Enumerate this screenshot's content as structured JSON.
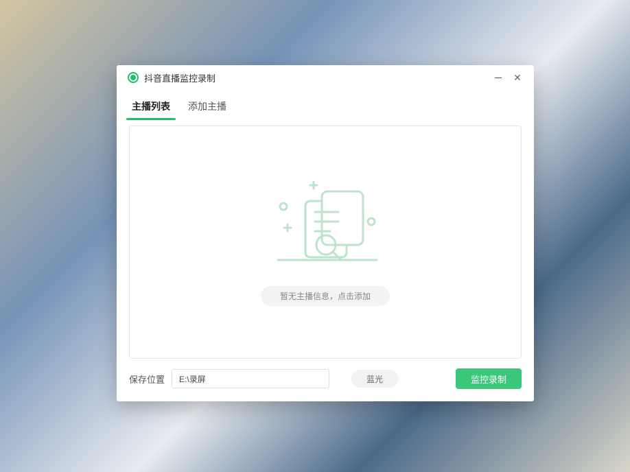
{
  "window": {
    "title": "抖音直播监控录制"
  },
  "tabs": [
    {
      "label": "主播列表",
      "active": true
    },
    {
      "label": "添加主播",
      "active": false
    }
  ],
  "empty": {
    "message": "暂无主播信息，点击添加"
  },
  "footer": {
    "save_label": "保存位置",
    "path_value": "E:\\录屏",
    "quality_label": "蓝光",
    "record_label": "监控录制"
  }
}
